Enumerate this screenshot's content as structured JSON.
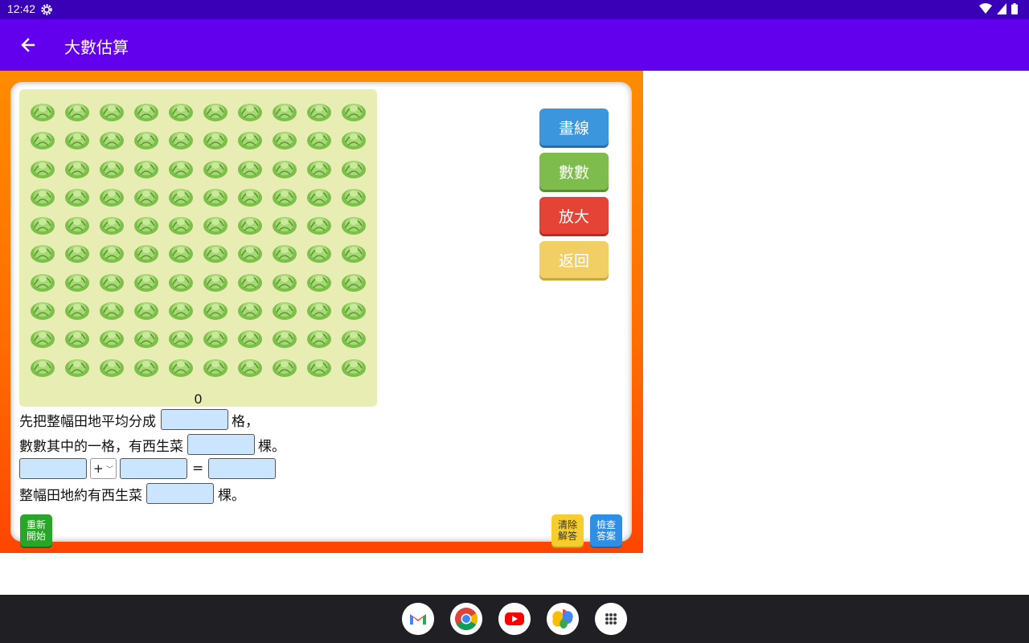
{
  "status_bar": {
    "time": "12:42"
  },
  "app_bar": {
    "title": "大數估算"
  },
  "field": {
    "rows": 10,
    "cols": 10,
    "count": "0"
  },
  "side_buttons": {
    "draw": "畫線",
    "count": "數數",
    "zoom": "放大",
    "back": "返回"
  },
  "instructions": {
    "line1_prefix": "先把整幅田地平均分成",
    "line1_suffix": "格，",
    "line2_prefix": "數數其中的一格，有西生菜",
    "line2_suffix": "棵。",
    "operator": "+",
    "equals": "=",
    "line4_prefix": "整幅田地約有西生菜",
    "line4_suffix": "棵。"
  },
  "bottom_buttons": {
    "restart": "重新\n開始",
    "clear": "清除\n解答",
    "check": "檢查\n答案"
  },
  "colors": {
    "status_bar": "#3a00b8",
    "app_bar": "#6200ee",
    "frame": "#ff7a00",
    "field": "#e8edb4"
  }
}
